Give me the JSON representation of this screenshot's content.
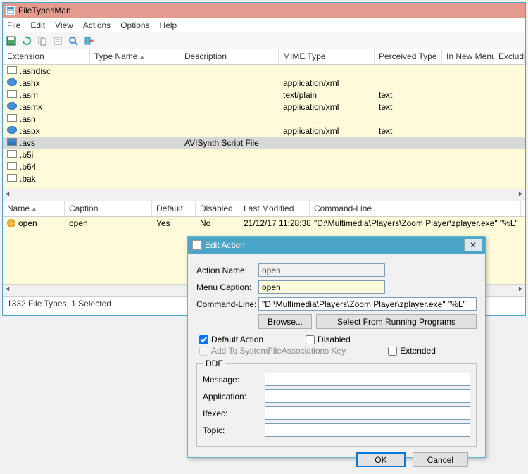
{
  "window": {
    "title": "FileTypesMan"
  },
  "menu": [
    "File",
    "Edit",
    "View",
    "Actions",
    "Options",
    "Help"
  ],
  "top_grid": {
    "headers": [
      "Extension",
      "Type Name",
      "Description",
      "MIME Type",
      "Perceived Type",
      "In New Menu",
      "Excluded"
    ],
    "sort_col": 1,
    "rows": [
      {
        "ext": ".ashdisc",
        "mime": "",
        "perc": ""
      },
      {
        "ext": ".ashx",
        "mime": "application/xml",
        "perc": ""
      },
      {
        "ext": ".asm",
        "mime": "text/plain",
        "perc": "text"
      },
      {
        "ext": ".asmx",
        "mime": "application/xml",
        "perc": "text"
      },
      {
        "ext": ".asn",
        "mime": "",
        "perc": ""
      },
      {
        "ext": ".aspx",
        "mime": "application/xml",
        "perc": "text"
      },
      {
        "ext": ".avs",
        "desc": "AVISynth Script File",
        "mime": "",
        "perc": "",
        "selected": true,
        "icon": "film"
      },
      {
        "ext": ".b5i",
        "mime": "",
        "perc": ""
      },
      {
        "ext": ".b64",
        "mime": "",
        "perc": ""
      },
      {
        "ext": ".bak",
        "mime": "",
        "perc": ""
      }
    ]
  },
  "bottom_grid": {
    "headers": [
      "Name",
      "Caption",
      "Default",
      "Disabled",
      "Last Modified",
      "Command-Line"
    ],
    "sort_col": 0,
    "rows": [
      {
        "name": "open",
        "caption": "open",
        "default": "Yes",
        "disabled": "No",
        "modified": "21/12/17 11:28:38",
        "cmd": "\"D:\\Multimedia\\Players\\Zoom Player\\zplayer.exe\" \"%L\""
      }
    ]
  },
  "status": "1332 File Types, 1 Selected",
  "dialog": {
    "title": "Edit Action",
    "action_name_label": "Action Name:",
    "action_name": "open",
    "menu_caption_label": "Menu Caption:",
    "menu_caption": "open",
    "command_line_label": "Command-Line:",
    "command_line": "\"D:\\Multimedia\\Players\\Zoom Player\\zplayer.exe\" \"%L\"",
    "browse": "Browse...",
    "select_running": "Select From Running Programs",
    "default_action": "Default Action",
    "disabled": "Disabled",
    "add_to_sys": "Add To SystemFileAssociations Key",
    "extended": "Extended",
    "dde_legend": "DDE",
    "dde_message": "Message:",
    "dde_application": "Application:",
    "dde_ifexec": "Ifexec:",
    "dde_topic": "Topic:",
    "ok": "OK",
    "cancel": "Cancel"
  }
}
